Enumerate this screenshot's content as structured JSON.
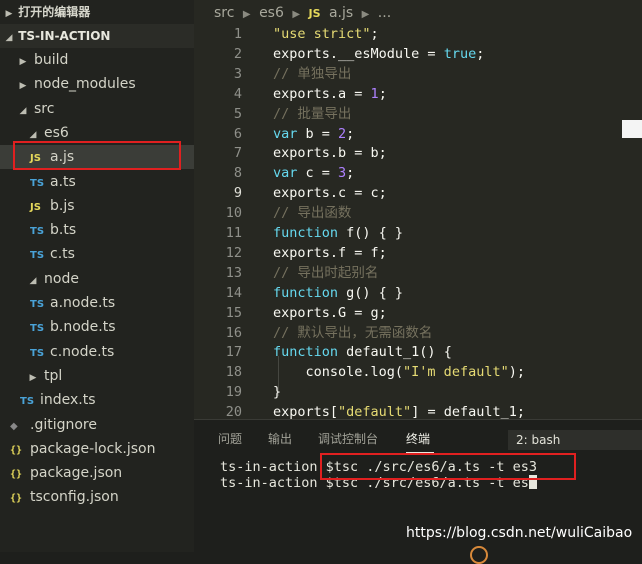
{
  "sidebar": {
    "open_editors": "打开的编辑器",
    "project": "TS-IN-ACTION",
    "items": [
      {
        "label": "build",
        "chev": "▶",
        "icon": ""
      },
      {
        "label": "node_modules",
        "chev": "▶",
        "icon": ""
      },
      {
        "label": "src",
        "chev": "◢",
        "icon": ""
      },
      {
        "label": "es6",
        "chev": "◢",
        "icon": ""
      },
      {
        "label": "a.js",
        "chev": "",
        "icon": "JS"
      },
      {
        "label": "a.ts",
        "chev": "",
        "icon": "TS"
      },
      {
        "label": "b.js",
        "chev": "",
        "icon": "JS"
      },
      {
        "label": "b.ts",
        "chev": "",
        "icon": "TS"
      },
      {
        "label": "c.ts",
        "chev": "",
        "icon": "TS"
      },
      {
        "label": "node",
        "chev": "◢",
        "icon": ""
      },
      {
        "label": "a.node.ts",
        "chev": "",
        "icon": "TS"
      },
      {
        "label": "b.node.ts",
        "chev": "",
        "icon": "TS"
      },
      {
        "label": "c.node.ts",
        "chev": "",
        "icon": "TS"
      },
      {
        "label": "tpl",
        "chev": "▶",
        "icon": ""
      },
      {
        "label": "index.ts",
        "chev": "",
        "icon": "TS"
      },
      {
        "label": ".gitignore",
        "chev": "",
        "icon": "◆"
      },
      {
        "label": "package-lock.json",
        "chev": "",
        "icon": "{}"
      },
      {
        "label": "package.json",
        "chev": "",
        "icon": "{}"
      },
      {
        "label": "tsconfig.json",
        "chev": "",
        "icon": "{}"
      }
    ]
  },
  "breadcrumb": {
    "src": "src",
    "es6": "es6",
    "badge": "JS",
    "file": "a.js",
    "more": "..."
  },
  "editor": {
    "current_line": 9,
    "lines": [
      {
        "n": "1",
        "t": [
          [
            "str",
            "\"use strict\""
          ],
          [
            "id",
            ";"
          ]
        ]
      },
      {
        "n": "2",
        "t": [
          [
            "id",
            "exports.__esModule = "
          ],
          [
            "kw",
            "true"
          ],
          [
            "id",
            ";"
          ]
        ]
      },
      {
        "n": "3",
        "t": [
          [
            "cm",
            "// 单独导出"
          ]
        ]
      },
      {
        "n": "4",
        "t": [
          [
            "id",
            "exports.a = "
          ],
          [
            "num",
            "1"
          ],
          [
            "id",
            ";"
          ]
        ]
      },
      {
        "n": "5",
        "t": [
          [
            "cm",
            "// 批量导出"
          ]
        ]
      },
      {
        "n": "6",
        "t": [
          [
            "kw",
            "var"
          ],
          [
            "id",
            " b = "
          ],
          [
            "num",
            "2"
          ],
          [
            "id",
            ";"
          ]
        ]
      },
      {
        "n": "7",
        "t": [
          [
            "id",
            "exports.b = b;"
          ]
        ]
      },
      {
        "n": "8",
        "t": [
          [
            "kw",
            "var"
          ],
          [
            "id",
            " c = "
          ],
          [
            "num",
            "3"
          ],
          [
            "id",
            ";"
          ]
        ]
      },
      {
        "n": "9",
        "t": [
          [
            "id",
            "exports.c = c;"
          ]
        ]
      },
      {
        "n": "10",
        "t": [
          [
            "cm",
            "// 导出函数"
          ]
        ]
      },
      {
        "n": "11",
        "t": [
          [
            "kw",
            "function"
          ],
          [
            "id",
            " f() { }"
          ]
        ]
      },
      {
        "n": "12",
        "t": [
          [
            "id",
            "exports.f = f;"
          ]
        ]
      },
      {
        "n": "13",
        "t": [
          [
            "cm",
            "// 导出时起别名"
          ]
        ]
      },
      {
        "n": "14",
        "t": [
          [
            "kw",
            "function"
          ],
          [
            "id",
            " g() { }"
          ]
        ]
      },
      {
        "n": "15",
        "t": [
          [
            "id",
            "exports.G = g;"
          ]
        ]
      },
      {
        "n": "16",
        "t": [
          [
            "cm",
            "// 默认导出，无需函数名"
          ]
        ]
      },
      {
        "n": "17",
        "t": [
          [
            "kw",
            "function"
          ],
          [
            "id",
            " default_1() {"
          ]
        ]
      },
      {
        "n": "18",
        "t": [
          [
            "id",
            "    console.log("
          ],
          [
            "str",
            "\"I'm default\""
          ],
          [
            "id",
            ");"
          ]
        ]
      },
      {
        "n": "19",
        "t": [
          [
            "id",
            "}"
          ]
        ]
      },
      {
        "n": "20",
        "t": [
          [
            "id",
            "exports["
          ],
          [
            "str",
            "\"default\""
          ],
          [
            "id",
            "] = default_1;"
          ]
        ]
      }
    ]
  },
  "panel": {
    "tabs": [
      "问题",
      "输出",
      "调试控制台",
      "终端"
    ],
    "active_tab": "终端",
    "terminal_select": "2: bash",
    "terminal_lines": [
      "ts-in-action $tsc ./src/es6/a.ts -t es3",
      "ts-in-action $tsc ./src/es6/a.ts -t es"
    ]
  },
  "watermark": "https://blog.csdn.net/wuliCaibao",
  "colors": {
    "highlight_box": "#e02020",
    "keyword": "#66d9ef",
    "string": "#e6db74",
    "number": "#ae81ff",
    "comment": "#75715e"
  }
}
